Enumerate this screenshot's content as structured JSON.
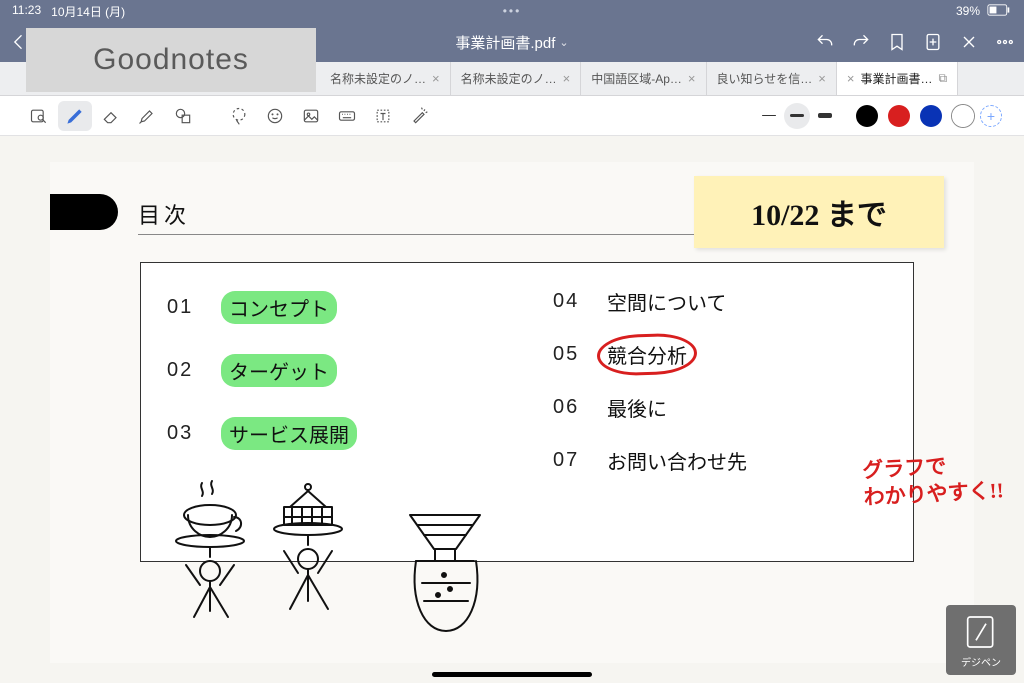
{
  "status": {
    "time": "11:23",
    "date": "10月14日 (月)",
    "battery": "39%"
  },
  "app_overlay": "Goodnotes",
  "navbar": {
    "title": "事業計画書.pdf"
  },
  "tabs": [
    {
      "label": "名称未設定のノ…",
      "active": false
    },
    {
      "label": "名称未設定のノ…",
      "active": false
    },
    {
      "label": "中国語区域-Ap…",
      "active": false
    },
    {
      "label": "良い知らせを信…",
      "active": false
    },
    {
      "label": "事業計画書…",
      "active": true
    }
  ],
  "colors": {
    "black": "#000000",
    "red": "#d81f1f",
    "blue": "#0933b5"
  },
  "page": {
    "toc_title": "目次",
    "sticky_note": "10/22 まで",
    "red_annotation": "グラフで\nわかりやすく!!",
    "items_left": [
      {
        "num": "01",
        "label": "コンセプト",
        "highlight": true
      },
      {
        "num": "02",
        "label": "ターゲット",
        "highlight": true
      },
      {
        "num": "03",
        "label": "サービス展開",
        "highlight": true
      }
    ],
    "items_right": [
      {
        "num": "04",
        "label": "空間について"
      },
      {
        "num": "05",
        "label": "競合分析",
        "circled": true
      },
      {
        "num": "06",
        "label": "最後に"
      },
      {
        "num": "07",
        "label": "お問い合わせ先"
      }
    ]
  },
  "watermark": "デジペン"
}
